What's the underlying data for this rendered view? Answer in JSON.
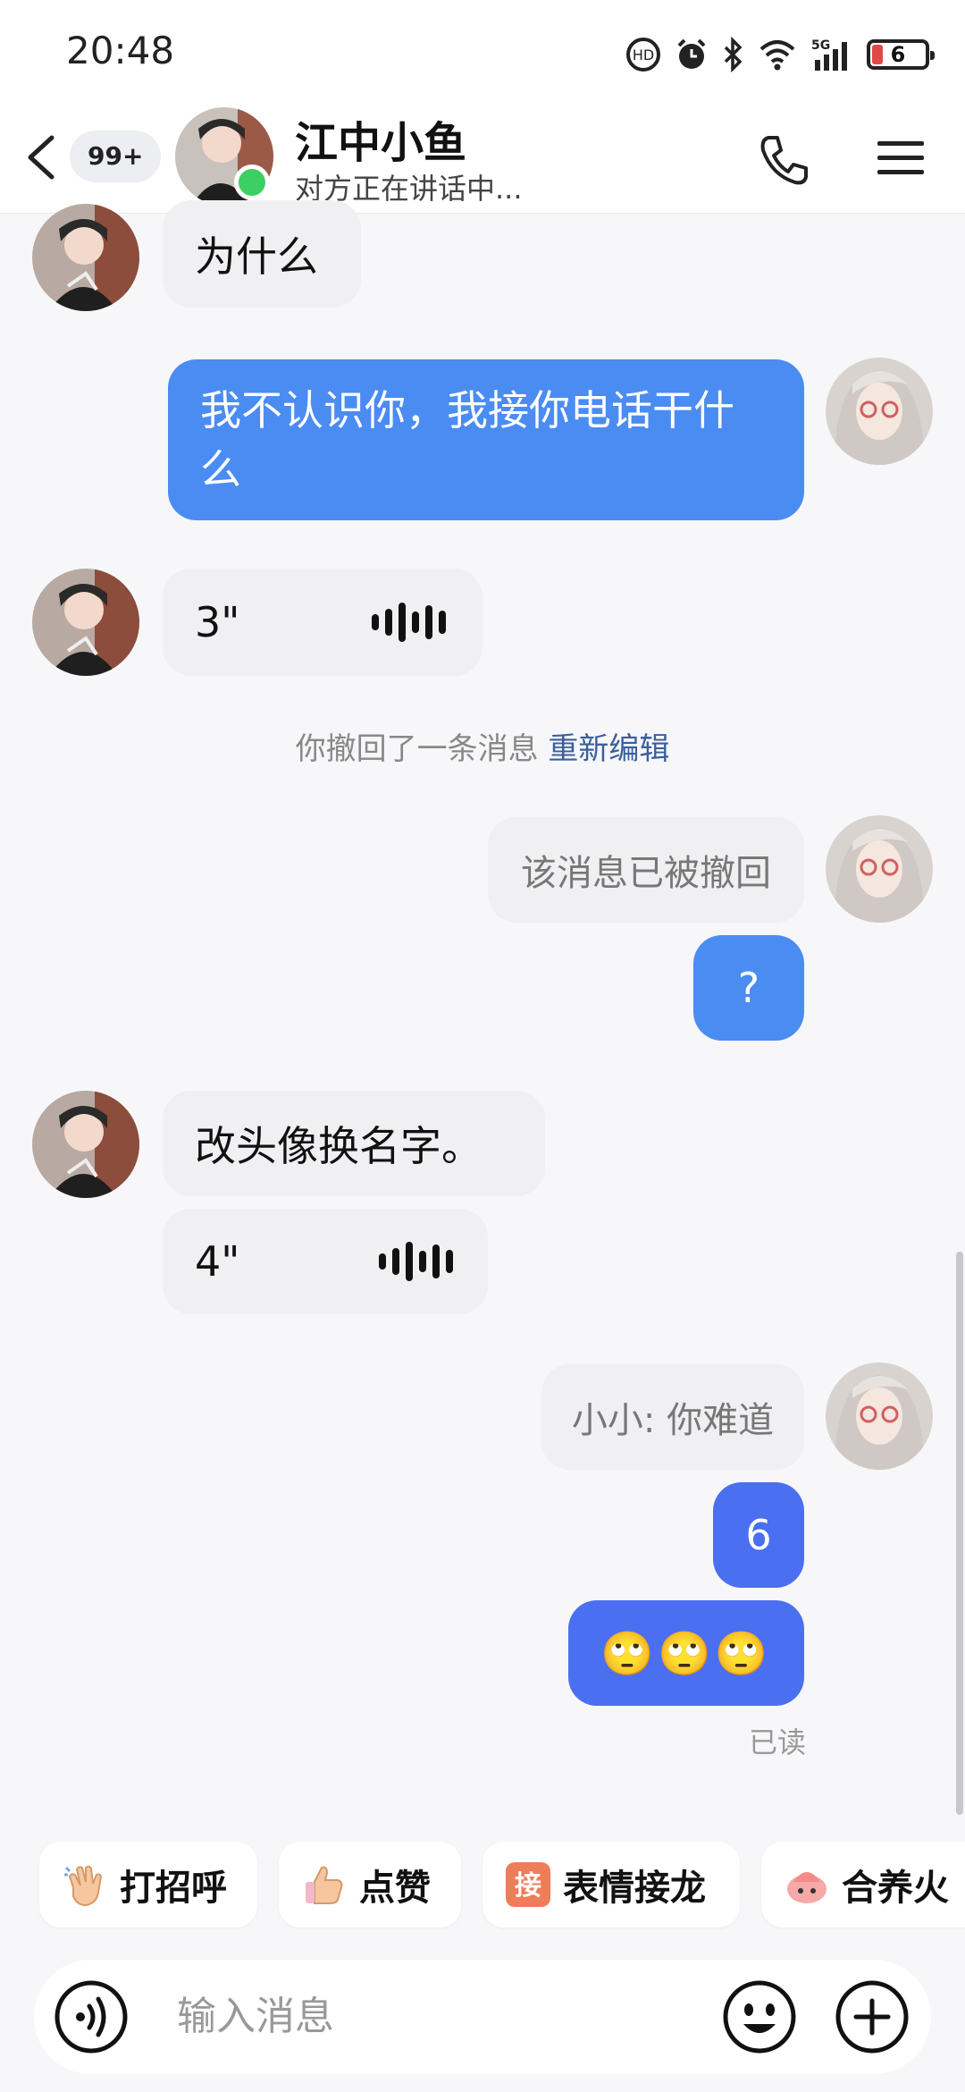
{
  "status_bar": {
    "time": "20:48",
    "battery": "6",
    "signal_label": "5G"
  },
  "header": {
    "unread_count": "99+",
    "contact_name": "江中小鱼",
    "contact_status": "对方正在讲话中..."
  },
  "messages": {
    "m1_text": "为什么",
    "m2_text": "我不认识你，我接你电话干什么",
    "m3_voice": "3\"",
    "system_text": "你撤回了一条消息",
    "system_link": "重新编辑",
    "m4_recalled": "该消息已被撤回",
    "m5_text": "?",
    "m6_text": "改头像换名字。",
    "m7_voice": "4\"",
    "m8_quote": "小小: 你难道",
    "m9_text": "6",
    "m10_text": "🙄🙄🙄",
    "read_status": "已读"
  },
  "quick_replies": [
    {
      "label": "打招呼",
      "icon": "wave-hand-icon"
    },
    {
      "label": "点赞",
      "icon": "thumbs-up-icon"
    },
    {
      "label": "表情接龙",
      "icon": "jie-badge-icon",
      "badge": "接"
    },
    {
      "label": "合养火",
      "icon": "spark-icon"
    }
  ],
  "input": {
    "placeholder": "输入消息"
  },
  "colors": {
    "bubble_out": "#4b8cf3",
    "bubble_out_dark": "#4a6ff0",
    "bubble_in": "#f0f0f3",
    "online": "#3ecf62",
    "system_link": "#3a5f9e"
  }
}
